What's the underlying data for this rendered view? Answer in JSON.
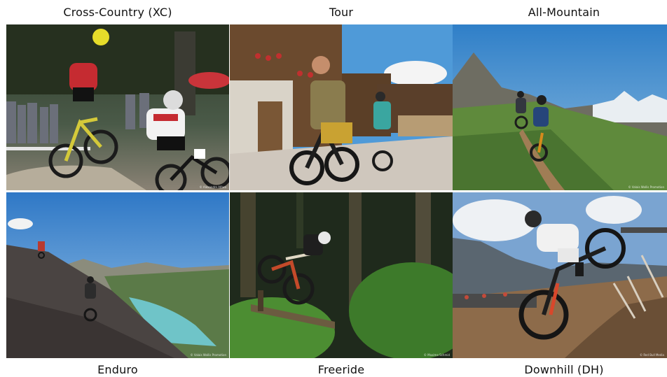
{
  "categories": [
    {
      "label": "Cross-Country (XC)",
      "credit": "© Alexandre Alfaro"
    },
    {
      "label": "Tour",
      "credit": ""
    },
    {
      "label": "All-Mountain",
      "credit": "© Valais Wallis Promotion"
    },
    {
      "label": "Enduro",
      "credit": "© Valais Wallis Promotion"
    },
    {
      "label": "Freeride",
      "credit": "© Maxime Schmid"
    },
    {
      "label": "Downhill (DH)",
      "credit": "© Red Bull Media"
    }
  ]
}
